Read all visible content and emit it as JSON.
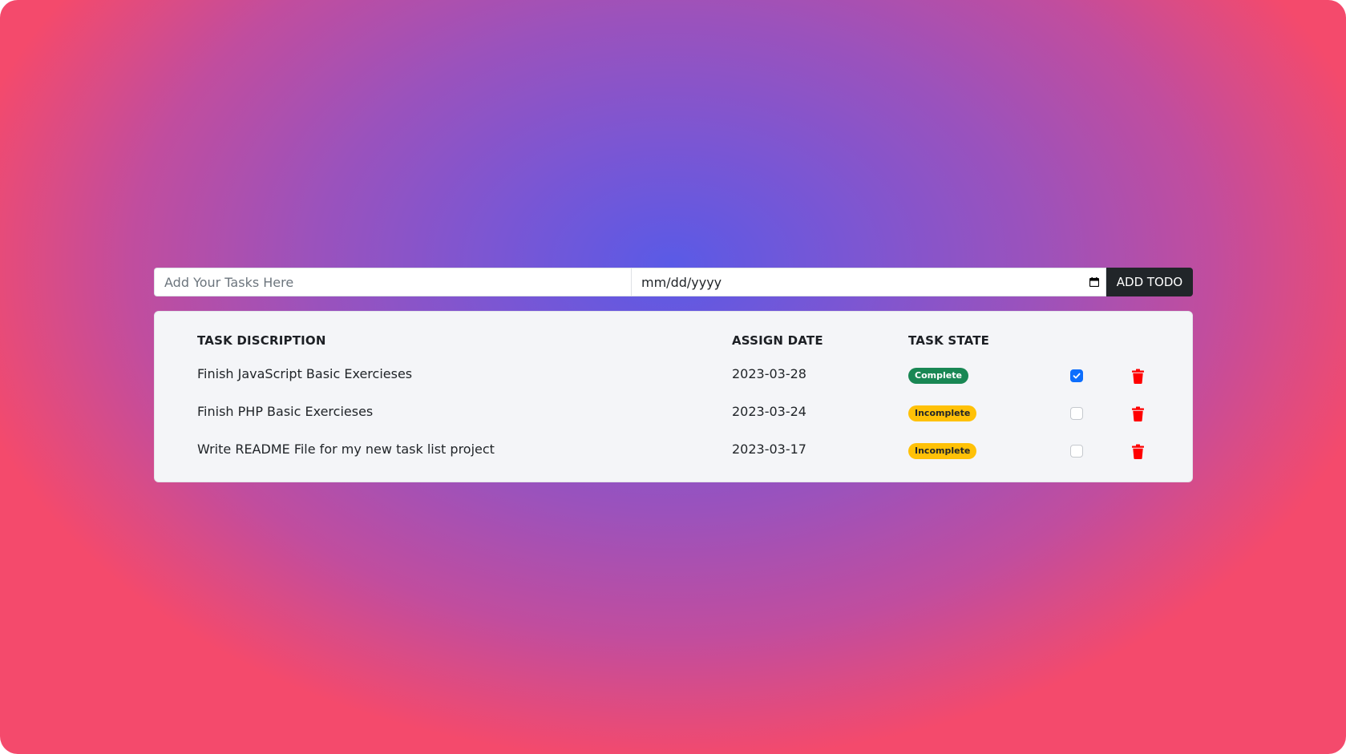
{
  "form": {
    "task_placeholder": "Add Your Tasks Here",
    "task_value": "",
    "date_placeholder": "mm/dd/yyyy",
    "add_button": "ADD TODO"
  },
  "table": {
    "headers": {
      "description": "TASK DISCRIPTION",
      "date": "ASSIGN DATE",
      "state": "TASK STATE"
    },
    "rows": [
      {
        "description": "Finish JavaScript Basic Exercieses",
        "date": "2023-03-28",
        "state": "Complete",
        "checked": true
      },
      {
        "description": "Finish PHP Basic Exercieses",
        "date": "2023-03-24",
        "state": "Incomplete",
        "checked": false
      },
      {
        "description": "Write README File for my new task list project",
        "date": "2023-03-17",
        "state": "Incomplete",
        "checked": false
      }
    ]
  },
  "icons": {
    "calendar": "calendar-icon",
    "delete": "trash-icon",
    "check": "check-icon"
  },
  "colors": {
    "complete_badge": "#198754",
    "incomplete_badge": "#ffc107",
    "checkbox_checked": "#0d6efd",
    "delete_icon": "#ff0000",
    "add_button_bg": "#212529",
    "card_bg": "#f4f5f8"
  }
}
